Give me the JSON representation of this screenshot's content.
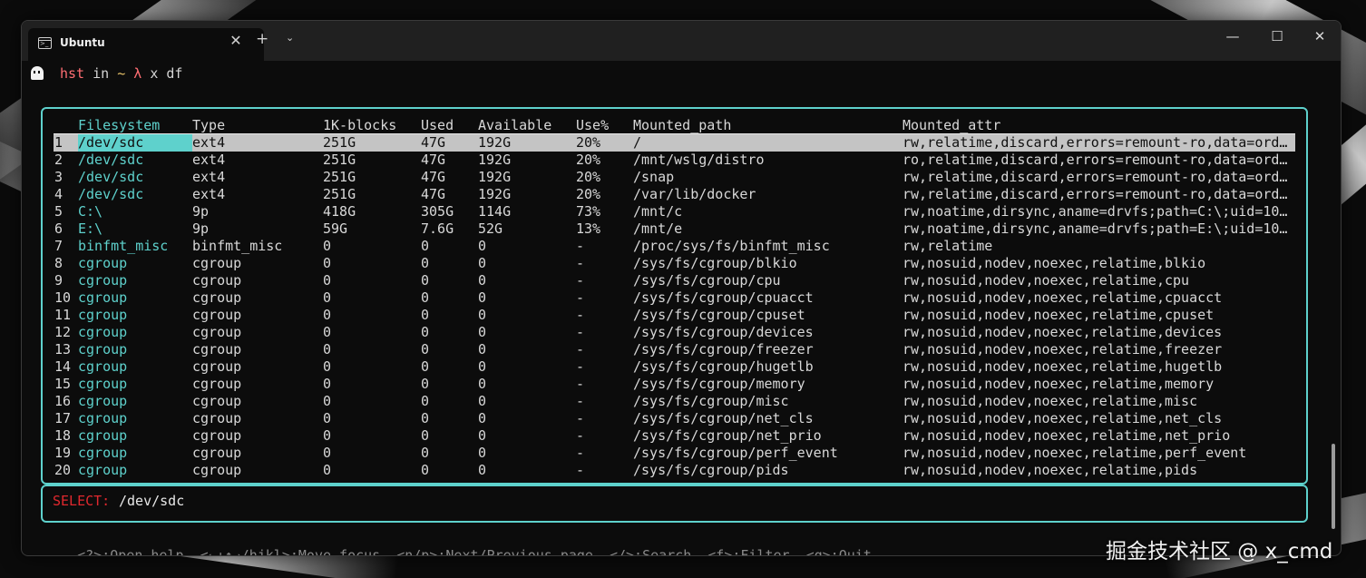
{
  "window": {
    "tab_title": "Ubuntu",
    "new_tab_label": "+",
    "tab_dropdown_label": "⌄",
    "tab_close_label": "✕",
    "minimize_label": "—",
    "maximize_label": "☐",
    "close_label": "✕"
  },
  "prompt": {
    "user": "hst",
    "in_word": "in",
    "path": "~",
    "symbol": "λ",
    "command": "x df"
  },
  "table": {
    "headers": {
      "filesystem": "Filesystem",
      "type": "Type",
      "blocks": "1K-blocks",
      "used": "Used",
      "available": "Available",
      "use_pct": "Use%",
      "mounted_path": "Mounted_path",
      "mounted_attr": "Mounted_attr"
    },
    "selected_index": 0,
    "rows": [
      {
        "num": "1",
        "fs": "/dev/sdc",
        "type": "ext4",
        "blocks": "251G",
        "used": "47G",
        "avail": "192G",
        "pct": "20%",
        "path": "/",
        "attr": "rw,relatime,discard,errors=remount-ro,data=ord…"
      },
      {
        "num": "2",
        "fs": "/dev/sdc",
        "type": "ext4",
        "blocks": "251G",
        "used": "47G",
        "avail": "192G",
        "pct": "20%",
        "path": "/mnt/wslg/distro",
        "attr": "ro,relatime,discard,errors=remount-ro,data=ord…"
      },
      {
        "num": "3",
        "fs": "/dev/sdc",
        "type": "ext4",
        "blocks": "251G",
        "used": "47G",
        "avail": "192G",
        "pct": "20%",
        "path": "/snap",
        "attr": "rw,relatime,discard,errors=remount-ro,data=ord…"
      },
      {
        "num": "4",
        "fs": "/dev/sdc",
        "type": "ext4",
        "blocks": "251G",
        "used": "47G",
        "avail": "192G",
        "pct": "20%",
        "path": "/var/lib/docker",
        "attr": "rw,relatime,discard,errors=remount-ro,data=ord…"
      },
      {
        "num": "5",
        "fs": "C:\\",
        "type": "9p",
        "blocks": "418G",
        "used": "305G",
        "avail": "114G",
        "pct": "73%",
        "path": "/mnt/c",
        "attr": "rw,noatime,dirsync,aname=drvfs;path=C:\\;uid=10…"
      },
      {
        "num": "6",
        "fs": "E:\\",
        "type": "9p",
        "blocks": "59G",
        "used": "7.6G",
        "avail": "52G",
        "pct": "13%",
        "path": "/mnt/e",
        "attr": "rw,noatime,dirsync,aname=drvfs;path=E:\\;uid=10…"
      },
      {
        "num": "7",
        "fs": "binfmt_misc",
        "type": "binfmt_misc",
        "blocks": "0",
        "used": "0",
        "avail": "0",
        "pct": "-",
        "path": "/proc/sys/fs/binfmt_misc",
        "attr": "rw,relatime"
      },
      {
        "num": "8",
        "fs": "cgroup",
        "type": "cgroup",
        "blocks": "0",
        "used": "0",
        "avail": "0",
        "pct": "-",
        "path": "/sys/fs/cgroup/blkio",
        "attr": "rw,nosuid,nodev,noexec,relatime,blkio"
      },
      {
        "num": "9",
        "fs": "cgroup",
        "type": "cgroup",
        "blocks": "0",
        "used": "0",
        "avail": "0",
        "pct": "-",
        "path": "/sys/fs/cgroup/cpu",
        "attr": "rw,nosuid,nodev,noexec,relatime,cpu"
      },
      {
        "num": "10",
        "fs": "cgroup",
        "type": "cgroup",
        "blocks": "0",
        "used": "0",
        "avail": "0",
        "pct": "-",
        "path": "/sys/fs/cgroup/cpuacct",
        "attr": "rw,nosuid,nodev,noexec,relatime,cpuacct"
      },
      {
        "num": "11",
        "fs": "cgroup",
        "type": "cgroup",
        "blocks": "0",
        "used": "0",
        "avail": "0",
        "pct": "-",
        "path": "/sys/fs/cgroup/cpuset",
        "attr": "rw,nosuid,nodev,noexec,relatime,cpuset"
      },
      {
        "num": "12",
        "fs": "cgroup",
        "type": "cgroup",
        "blocks": "0",
        "used": "0",
        "avail": "0",
        "pct": "-",
        "path": "/sys/fs/cgroup/devices",
        "attr": "rw,nosuid,nodev,noexec,relatime,devices"
      },
      {
        "num": "13",
        "fs": "cgroup",
        "type": "cgroup",
        "blocks": "0",
        "used": "0",
        "avail": "0",
        "pct": "-",
        "path": "/sys/fs/cgroup/freezer",
        "attr": "rw,nosuid,nodev,noexec,relatime,freezer"
      },
      {
        "num": "14",
        "fs": "cgroup",
        "type": "cgroup",
        "blocks": "0",
        "used": "0",
        "avail": "0",
        "pct": "-",
        "path": "/sys/fs/cgroup/hugetlb",
        "attr": "rw,nosuid,nodev,noexec,relatime,hugetlb"
      },
      {
        "num": "15",
        "fs": "cgroup",
        "type": "cgroup",
        "blocks": "0",
        "used": "0",
        "avail": "0",
        "pct": "-",
        "path": "/sys/fs/cgroup/memory",
        "attr": "rw,nosuid,nodev,noexec,relatime,memory"
      },
      {
        "num": "16",
        "fs": "cgroup",
        "type": "cgroup",
        "blocks": "0",
        "used": "0",
        "avail": "0",
        "pct": "-",
        "path": "/sys/fs/cgroup/misc",
        "attr": "rw,nosuid,nodev,noexec,relatime,misc"
      },
      {
        "num": "17",
        "fs": "cgroup",
        "type": "cgroup",
        "blocks": "0",
        "used": "0",
        "avail": "0",
        "pct": "-",
        "path": "/sys/fs/cgroup/net_cls",
        "attr": "rw,nosuid,nodev,noexec,relatime,net_cls"
      },
      {
        "num": "18",
        "fs": "cgroup",
        "type": "cgroup",
        "blocks": "0",
        "used": "0",
        "avail": "0",
        "pct": "-",
        "path": "/sys/fs/cgroup/net_prio",
        "attr": "rw,nosuid,nodev,noexec,relatime,net_prio"
      },
      {
        "num": "19",
        "fs": "cgroup",
        "type": "cgroup",
        "blocks": "0",
        "used": "0",
        "avail": "0",
        "pct": "-",
        "path": "/sys/fs/cgroup/perf_event",
        "attr": "rw,nosuid,nodev,noexec,relatime,perf_event"
      },
      {
        "num": "20",
        "fs": "cgroup",
        "type": "cgroup",
        "blocks": "0",
        "used": "0",
        "avail": "0",
        "pct": "-",
        "path": "/sys/fs/cgroup/pids",
        "attr": "rw,nosuid,nodev,noexec,relatime,pids"
      }
    ]
  },
  "select": {
    "label": "SELECT:",
    "value": "/dev/sdc"
  },
  "help": [
    "<?>:Open help",
    "<←↓↑→/hjkl>:Move focus",
    "<n/p>:Next/Previous page",
    "</>:Search",
    "<f>:Filter",
    "<q>:Quit"
  ],
  "watermark": "掘金技术社区 @ x_cmd",
  "colors": {
    "accent": "#5ed1cc",
    "select_label": "#e0282e",
    "prompt_user": "#ff6e73",
    "prompt_path": "#e9c46a",
    "selected_row_bg": "#c4c4c4"
  }
}
